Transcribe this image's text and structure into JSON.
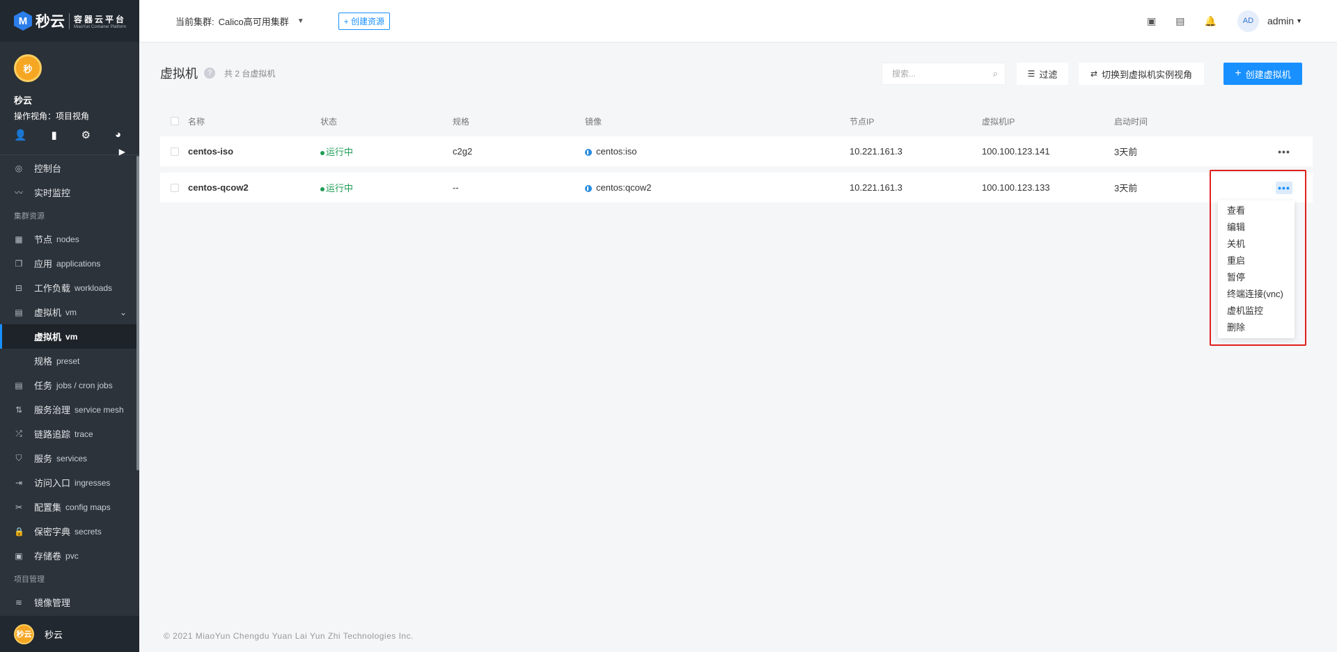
{
  "brand": {
    "name": "秒云",
    "title_cn": "容器云平台",
    "title_en": "MiaoYun Container Platform"
  },
  "project": {
    "avatar_text": "秒",
    "name": "秒云",
    "view_label": "操作视角：项目视角"
  },
  "menu": {
    "console": "控制台",
    "monitor": "实时监控",
    "group_cluster": "集群资源",
    "nodes": {
      "cn": "节点",
      "en": "nodes"
    },
    "applications": {
      "cn": "应用",
      "en": "applications"
    },
    "workloads": {
      "cn": "工作负载",
      "en": "workloads"
    },
    "vm": {
      "cn": "虚拟机",
      "en": "vm"
    },
    "vm_sub": {
      "cn": "虚拟机",
      "en": "vm"
    },
    "preset": {
      "cn": "规格",
      "en": "preset"
    },
    "jobs": {
      "cn": "任务",
      "en": "jobs / cron jobs"
    },
    "mesh": {
      "cn": "服务治理",
      "en": "service mesh"
    },
    "trace": {
      "cn": "链路追踪",
      "en": "trace"
    },
    "services": {
      "cn": "服务",
      "en": "services"
    },
    "ingresses": {
      "cn": "访问入口",
      "en": "ingresses"
    },
    "configmaps": {
      "cn": "配置集",
      "en": "config maps"
    },
    "secrets": {
      "cn": "保密字典",
      "en": "secrets"
    },
    "pvc": {
      "cn": "存储卷",
      "en": "pvc"
    },
    "group_project": "项目管理",
    "images": "镜像管理"
  },
  "bottom_user": {
    "avatar_text": "秒云",
    "name": "秒云"
  },
  "topbar": {
    "cluster_label": "当前集群:",
    "cluster_value": "Calico高可用集群",
    "create_resource": "+ 创建资源",
    "user_initials": "AD",
    "username": "admin"
  },
  "page": {
    "title": "虚拟机",
    "count_text": "共 2 台虚拟机",
    "search_placeholder": "搜索...",
    "filter_label": "过滤",
    "switch_label": "切换到虚拟机实例视角",
    "create_label": "创建虚拟机"
  },
  "table": {
    "headers": [
      "名称",
      "状态",
      "规格",
      "镜像",
      "节点IP",
      "虚拟机IP",
      "启动时间"
    ],
    "rows": [
      {
        "name": "centos-iso",
        "status": "运行中",
        "spec": "c2g2",
        "image": "centos:iso",
        "node_ip": "10.221.161.3",
        "vm_ip": "100.100.123.141",
        "started": "3天前"
      },
      {
        "name": "centos-qcow2",
        "status": "运行中",
        "spec": "--",
        "image": "centos:qcow2",
        "node_ip": "10.221.161.3",
        "vm_ip": "100.100.123.133",
        "started": "3天前"
      }
    ]
  },
  "dropdown": [
    "查看",
    "编辑",
    "关机",
    "重启",
    "暂停",
    "终端连接(vnc)",
    "虚机监控",
    "删除"
  ],
  "footer": "© 2021 MiaoYun Chengdu Yuan Lai Yun Zhi Technologies Inc.",
  "colors": {
    "primary": "#1890ff",
    "sidebar": "#2d333a",
    "running": "#1f9d55",
    "highlight": "#e0201b"
  }
}
